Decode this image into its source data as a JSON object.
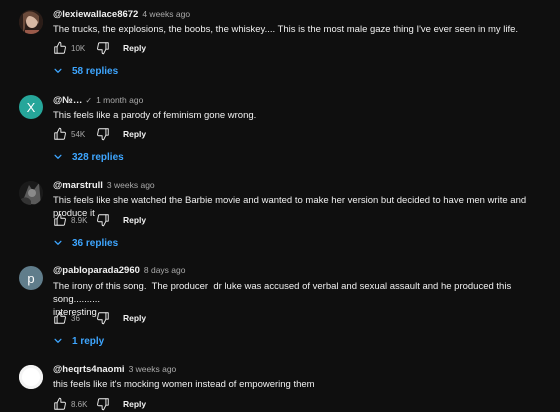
{
  "comments": [
    {
      "author": "@lexiewallace8672",
      "time": "4 weeks ago",
      "text": "The trucks, the explosions, the boobs, the whiskey.... This is the most male gaze thing I've ever seen in my life.",
      "likes": "10K",
      "reply_label": "Reply",
      "replies_label": "58 replies",
      "avatar": {
        "type": "photo",
        "colors": [
          "#6b4a3a",
          "#d9b8a3",
          "#2b1d18"
        ]
      }
    },
    {
      "author": "@№…",
      "verified_mark": "✓",
      "time": "1 month ago",
      "text": "This feels like a parody of feminism gone wrong.",
      "likes": "54K",
      "reply_label": "Reply",
      "replies_label": "328 replies",
      "avatar": {
        "type": "letter",
        "letter": "X",
        "color": "#26a69a"
      }
    },
    {
      "author": "@marstrull",
      "time": "3 weeks ago",
      "text": "This feels like she watched the Barbie movie and wanted to make her version but decided to have men write and produce it",
      "likes": "8.9K",
      "reply_label": "Reply",
      "replies_label": "36 replies",
      "avatar": {
        "type": "photo",
        "colors": [
          "#1a1a1a",
          "#7a7a7a",
          "#3a3a3a"
        ]
      }
    },
    {
      "author": "@pabloparada2960",
      "time": "8 days ago",
      "text": "The irony of this song.  The producer  dr luke was accused of verbal and sexual assault and he produced this song..........\ninteresting",
      "likes": "36",
      "reply_label": "Reply",
      "replies_label": "1 reply",
      "avatar": {
        "type": "letter",
        "letter": "p",
        "color": "#607d8b"
      }
    },
    {
      "author": "@heqrts4naomi",
      "time": "3 weeks ago",
      "text": "this feels like it's mocking women instead of empowering them",
      "likes": "8.6K",
      "reply_label": "Reply",
      "avatar": {
        "type": "photo",
        "colors": [
          "#f2f2f2",
          "#ffffff",
          "#dcdcdc"
        ]
      }
    }
  ],
  "colors": {
    "background": "#0f0f0f",
    "text_primary": "#f1f1f1",
    "text_secondary": "#aaaaaa",
    "link_blue": "#3ea6ff"
  },
  "icons": [
    "thumbs-up-icon",
    "thumbs-down-icon",
    "chevron-down-icon"
  ]
}
